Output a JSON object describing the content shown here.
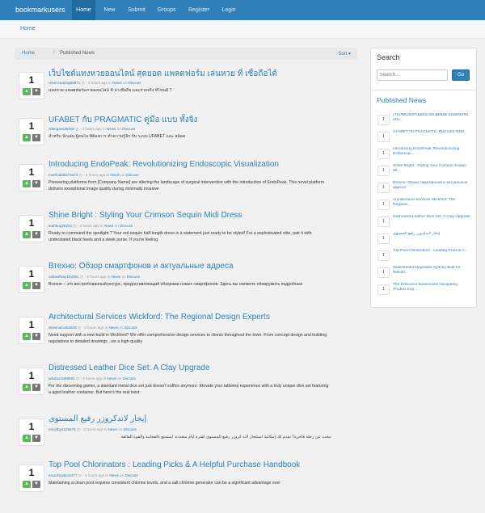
{
  "nav": {
    "brand": "bookmarkusers",
    "links": [
      "Home",
      "New",
      "Submit",
      "Groups",
      "Register",
      "Login"
    ]
  },
  "header": {
    "home": "Home"
  },
  "breadcrumb": {
    "home": "Home",
    "separator": "/",
    "current": "Published News",
    "sort": "Sort ▾"
  },
  "posts": [
    {
      "votes": "1",
      "title": "เว็บไซต์แทงหวยออนไลน์ สุดยอด แพลตฟอร์ม เล่นหวย ที่ เชื่อถือได้",
      "user": "rebeccaadog58971",
      "time": "3 hours ago",
      "desc": "แทงหวย แพลตฟอร์มหวยออนไลน์ ที่ น่าเชื่อถือ และจ่ายจริง ที่ไหนดี ?",
      "rtl": false
    },
    {
      "votes": "1",
      "title": "UFABET กับ PRAGMATIC คู่มือ แบบ ทั้งจิง",
      "user": "allengavs38392",
      "time": "3 hours ago",
      "desc": "สำหรับ นักเล่น ผู้สนใจ ที่ต้องการ ทำความรู้จัก กับ ระบบ UFABET และ สล็อต",
      "rtl": false
    },
    {
      "votes": "1",
      "title": "Introducing EndoPeak: Revolutionizing Endoscopic Visualization",
      "user": "martinabtkk74573",
      "time": "3 hours ago",
      "desc": "Pioneering platforms from [Company Name] are altering the landscape of surgical intervention with the introduction of EndoPeak. This novel platform delivers exceptional image quality during minimally invasive",
      "rtl": false
    },
    {
      "votes": "1",
      "title": "Shine Bright : Styling Your Crimson Sequin Midi Dress",
      "user": "leahbug28242",
      "time": "3 hours ago",
      "desc": "Ready to command the spotlight ? Your red sequin half-length dress is a statement just ready to be styled! For a sophisticated vibe, pair it with understated black heels and a sleek purse. If you're feeling",
      "rtl": false
    },
    {
      "votes": "1",
      "title": "Втехно: Обзор смартфонов и актуальные адреса",
      "user": "zabawfswy192061",
      "time": "3 hours ago",
      "desc": "Втехно – это востребованный ресурс, предоставляющий обзорами новых смартфонов. Здесь вы сможете обнаружить подробные",
      "rtl": false
    },
    {
      "votes": "1",
      "title": "Architectural Services Wickford: The Regional Design Experts",
      "user": "deannalcvi53648",
      "time": "3 hours ago",
      "desc": "Need support with a new build in Wickford? We offer comprehensive design services to clients throughout the town. From concept design and building regulations to detailed drawings , we a high-quality",
      "rtl": false
    },
    {
      "votes": "1",
      "title": "Distressed Leather Dice Set: A Clay Upgrade",
      "user": "jakubucra99681",
      "time": "3 hours ago",
      "desc": "For the discerning gamer, a standard metal dice set just doesn't suffice anymore. Elevate your tabletop experience with a truly unique dice set featuring a aged leather container. But here's the real twist:",
      "rtl": false
    },
    {
      "votes": "1",
      "title": "إيجار لاندكروزر رفيع المستوى",
      "user": "ericefbys125675",
      "time": "3 hours ago",
      "desc": "تبحث عن رحلة فاخرة؟ نقدم لك إمكانية استئجار لاند كروزر رفيع المستوى لفترة أيام متعددة. استمتع بالفخامة والقوة الفائقة",
      "rtl": true
    },
    {
      "votes": "1",
      "title": "Top Pool Chlorinators : Leading Picks & A Helpful Purchase Handbook",
      "user": "saoiohrpab16477",
      "time": "3 hours ago",
      "desc": "Maintaining a clean pool requires consistent chlorine levels, and a salt chlorine generator can be a significant advantage over",
      "rtl": false
    }
  ],
  "meta_words": {
    "sep": "-",
    "in": "in",
    "cat": "News",
    "on": "on",
    "discuss": "Discuss"
  },
  "sidebar": {
    "search_title": "Search",
    "search_placeholder": "Search...",
    "search_button": "Go",
    "published_title": "Published News",
    "items": [
      {
        "num": "1",
        "text": "เว็บไซต์แทงหวยออนไลน์ สุดยอด แพลตฟอร์ม เล่น..."
      },
      {
        "num": "1",
        "text": "UFABET กับ PRAGMATIC คู่มือ แบบ ทั้งจิง"
      },
      {
        "num": "1",
        "text": "Introducing EndoPeak: Revolutionizing Endoscopi..."
      },
      {
        "num": "1",
        "text": "Shine Bright : Styling Your Crimson Sequin Mi..."
      },
      {
        "num": "1",
        "text": "Втехно: Обзор смартфонов и актуальные адреса"
      },
      {
        "num": "1",
        "text": "Architectural Services Wickford: The Regiona..."
      },
      {
        "num": "1",
        "text": "Distressed Leather Dice Set: A Clay Upgrade"
      },
      {
        "num": "1",
        "text": "إيجار لاندكروزر رفيع المستوى"
      },
      {
        "num": "1",
        "text": "Top Pool Chlorinators : Leading Picks & A..."
      },
      {
        "num": "1",
        "text": "Switchboard Upgrades Sydney Built for Reliabl..."
      },
      {
        "num": "1",
        "text": "The Resource Businesses Navigating Product Exp..."
      }
    ]
  },
  "colors": {
    "primary": "#2f7fb8",
    "upvote": "#5cb85c",
    "downvote": "#777777"
  },
  "icons": {
    "upvote": "thumbs-up-icon",
    "downvote": "thumbs-down-icon"
  }
}
